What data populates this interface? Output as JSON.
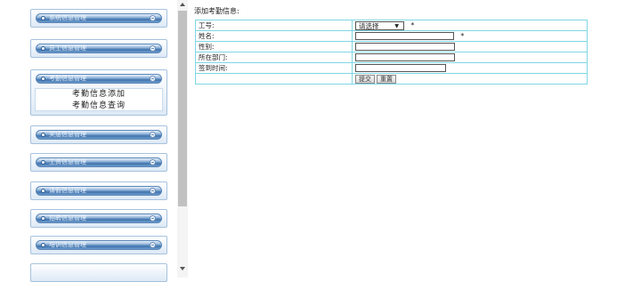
{
  "sidebar": {
    "groups": [
      {
        "title": "系统信息管理"
      },
      {
        "title": "员工信息管理"
      },
      {
        "title": "考勤信息管理",
        "items": [
          "考勤信息添加",
          "考勤信息查询"
        ]
      },
      {
        "title": "奖惩信息管理"
      },
      {
        "title": "工资信息管理"
      },
      {
        "title": "请假信息管理"
      },
      {
        "title": "招聘信息管理"
      },
      {
        "title": "培训信息管理"
      }
    ]
  },
  "form": {
    "heading": "添加考勤信息:",
    "fields": {
      "emp_id_label": "工号:",
      "emp_id_select": "请选择",
      "emp_id_required": "*",
      "name_label": "姓名:",
      "name_required": "*",
      "gender_label": "性别:",
      "dept_label": "所在部门:",
      "signin_label": "签到时间:"
    },
    "buttons": {
      "submit": "提交",
      "reset": "重置"
    }
  }
}
